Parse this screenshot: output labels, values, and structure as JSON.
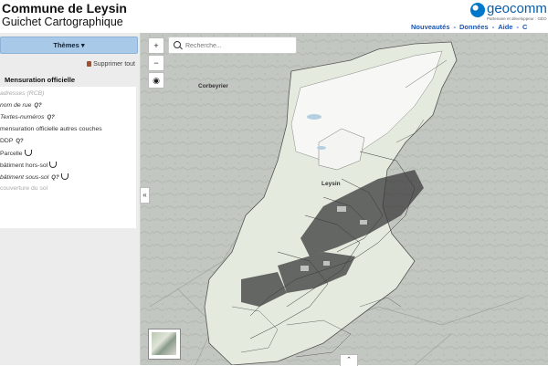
{
  "header": {
    "title": "Commune de Leysin",
    "subtitle": "Guichet Cartographique",
    "logo_text": "geocomm",
    "logo_tagline": "Partenaire et développeur : GÉO",
    "nav": [
      "Nouveautés",
      "Données",
      "Aide",
      "C"
    ]
  },
  "sidebar": {
    "themes_label": "Thèmes ▾",
    "remove_all_label": "Supprimer tout",
    "group_title": "Mensuration officielle",
    "layers": [
      {
        "label": "adresses (RCB)"
      },
      {
        "label": "nom de rue"
      },
      {
        "label": "Textes-numéros"
      },
      {
        "label": "mensuration officielle autres couches"
      },
      {
        "label": "DDP"
      },
      {
        "label": "Parcelle"
      },
      {
        "label": "bâtiment hors-sol"
      },
      {
        "label": "bâtiment sous-sol"
      },
      {
        "label": "couverture du sol"
      }
    ],
    "collapse_label": "«"
  },
  "map": {
    "search_placeholder": "Recherche...",
    "zoom_in": "+",
    "zoom_out": "−",
    "locate": "◉",
    "labels": [
      "Corbeyrier",
      "Leysin"
    ],
    "bottom_toggle": "⌃"
  }
}
